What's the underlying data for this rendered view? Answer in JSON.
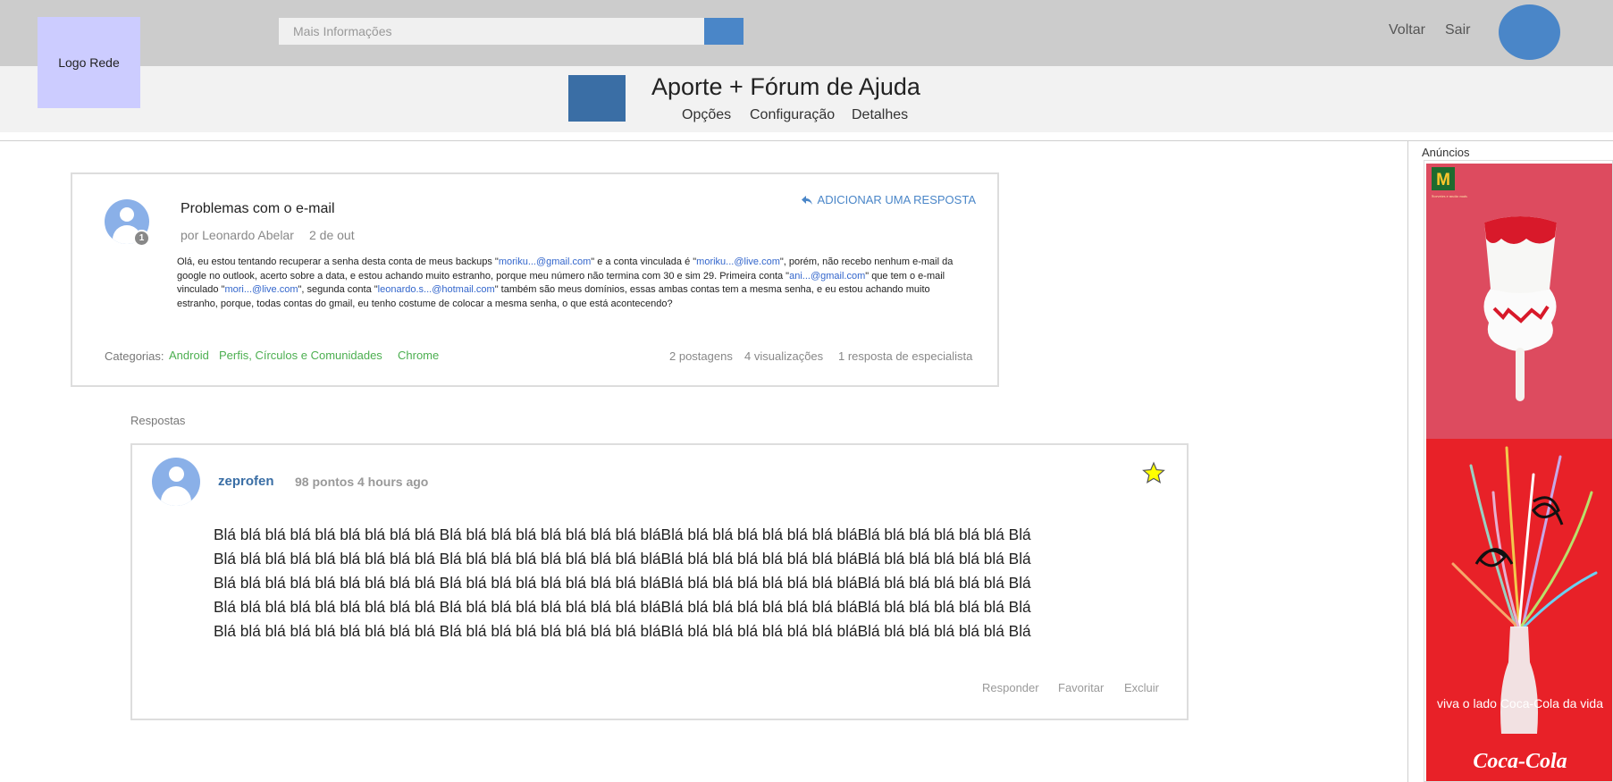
{
  "header": {
    "logo_text": "Logo Rede",
    "search_placeholder": "Mais Informações",
    "links": {
      "back": "Voltar",
      "logout": "Sair"
    }
  },
  "forum": {
    "title": "Aporte + Fórum de Ajuda",
    "nav": [
      "Opções",
      "Configuração",
      "Detalhes"
    ]
  },
  "question": {
    "title": "Problemas com o e-mail",
    "author": "por Leonardo Abelar",
    "date": "2 de out",
    "badge": "1",
    "add_reply": "ADICIONAR UMA RESPOSTA",
    "body": {
      "t1": "Olá, eu estou tentando recuperar a senha desta conta de meus backups \"",
      "e1": "moriku...@gmail.com",
      "t2": "\" e a conta vinculada é \"",
      "e2": "moriku...@live.com",
      "t3": "\", porém, não recebo nenhum e-mail da google no outlook, acerto sobre a data, e estou achando muito estranho, porque meu número não termina com 30 e sim 29. Primeira conta \"",
      "e3": "ani...@gmail.com",
      "t4": "\" que tem o e-mail vinculado \"",
      "e4": "mori...@live.com",
      "t5": "\", segunda conta \"",
      "e5": "leonardo.s...@hotmail.com",
      "t6": "\" também são meus domínios, essas ambas contas tem a mesma senha, e eu estou achando muito estranho, porque, todas contas do gmail, eu tenho costume de colocar a mesma senha, o que está acontecendo?"
    },
    "categories_label": "Categorias:",
    "categories": [
      "Android",
      "Perfis, Círculos e Comunidades",
      "Chrome"
    ],
    "stats": [
      "2 postagens",
      "4 visualizações",
      "1 resposta de especialista"
    ]
  },
  "answers": {
    "label": "Respostas",
    "items": [
      {
        "user": "zeprofen",
        "meta": "98 pontos 4 hours ago",
        "lines": [
          "Blá blá blá blá blá blá blá blá blá Blá blá blá blá blá blá blá blá bláBlá blá blá blá blá blá blá bláBlá blá blá blá blá blá Blá",
          "Blá blá blá blá blá blá blá blá blá Blá blá blá blá blá blá blá blá bláBlá blá blá blá blá blá blá bláBlá blá blá blá blá blá Blá",
          "Blá blá blá blá blá blá blá blá blá Blá blá blá blá blá blá blá blá bláBlá blá blá blá blá blá blá bláBlá blá blá blá blá blá Blá",
          "Blá blá blá blá blá blá blá blá blá Blá blá blá blá blá blá blá blá bláBlá blá blá blá blá blá blá bláBlá blá blá blá blá blá Blá",
          "Blá blá blá blá blá blá blá blá blá Blá blá blá blá blá blá blá blá bláBlá blá blá blá blá blá blá bláBlá blá blá blá blá blá Blá"
        ],
        "actions": [
          "Responder",
          "Favoritar",
          "Excluir"
        ]
      }
    ]
  },
  "ads": {
    "label": "Anúncios",
    "coke_slogan": "viva o lado Coca-Cola da vida",
    "coke_logo": "Coca-Cola",
    "mc_logo": "M",
    "mc_tagline": "Sorvetes e muito mais"
  },
  "colors": {
    "accent": "#4a86c8",
    "forum_icon": "#3a6ea5",
    "category": "#4caf50",
    "mc_ad_bg": "#dd4b5f",
    "coke_ad_bg": "#e82128"
  },
  "icons": [
    "search-icon",
    "reply-arrow-icon",
    "user-avatar-icon",
    "star-icon"
  ]
}
